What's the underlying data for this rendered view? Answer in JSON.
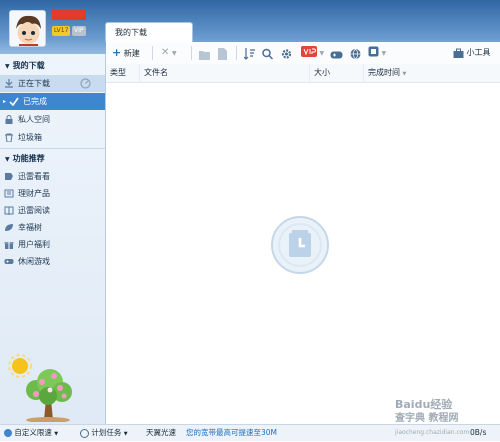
{
  "header": {
    "level": "LV17",
    "vip": "VIP",
    "tab_label": "我的下载"
  },
  "sidebar": {
    "my_downloads_title": "我的下载",
    "download_items": [
      {
        "label": "正在下载"
      },
      {
        "label": "已完成"
      },
      {
        "label": "私人空间"
      },
      {
        "label": "垃圾箱"
      }
    ],
    "features_title": "功能推荐",
    "feature_items": [
      {
        "label": "迅雷看看"
      },
      {
        "label": "理财产品"
      },
      {
        "label": "迅雷阅读"
      },
      {
        "label": "幸福树"
      },
      {
        "label": "用户福利"
      },
      {
        "label": "休闲游戏"
      }
    ]
  },
  "toolbar": {
    "new_label": "新建",
    "tools_label": "小工具"
  },
  "list": {
    "columns": [
      "类型",
      "文件名",
      "大小",
      "完成时间"
    ]
  },
  "statusbar": {
    "speed_mode": "自定义限速",
    "scheduled": "计划任务",
    "tianyi": "天翼光速",
    "promo": "您的宽带最高可提速至30M",
    "right_value": "0B/s"
  },
  "watermark": {
    "line1": "查字典 教程网",
    "line2": "jiaocheng.chazidian.com",
    "baidu": "Baidu经验"
  }
}
